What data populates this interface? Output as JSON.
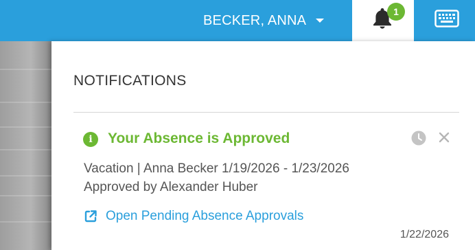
{
  "header": {
    "user_name": "BECKER, ANNA",
    "notification_count": "1",
    "icons": {
      "bell": "bell-icon",
      "keyboard": "keyboard-icon",
      "caret": "caret-down-icon"
    },
    "colors": {
      "bar": "#2a9fdc",
      "badge": "#6cb833"
    }
  },
  "notifications_panel": {
    "title": "NOTIFICATIONS",
    "items": [
      {
        "title": "Your Absence is Approved",
        "status_color": "#6cb833",
        "detail": "Vacation | Anna Becker 1/19/2026 - 1/23/2026",
        "approved_by": "Approved by Alexander Huber",
        "link_label": "Open Pending Absence Approvals",
        "date": "1/22/2026",
        "icons": [
          "info-icon",
          "clock-icon",
          "close-icon",
          "external-link-icon"
        ]
      }
    ]
  }
}
